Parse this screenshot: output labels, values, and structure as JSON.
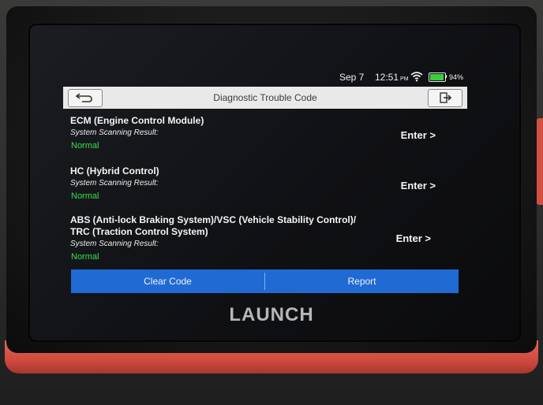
{
  "status_bar": {
    "date": "Sep 7",
    "time": "12:51",
    "time_suffix": "PM",
    "battery": "94%",
    "battery_fraction": 0.94,
    "colors": {
      "battery_fill": "#3ccd3a"
    }
  },
  "header": {
    "title": "Diagnostic Trouble Code",
    "back_icon": "back-arrow-icon",
    "exit_icon": "exit-icon"
  },
  "systems": [
    {
      "name": "ECM (Engine Control Module)",
      "result_label": "System Scanning Result:",
      "result": "Normal",
      "enter_label": "Enter >"
    },
    {
      "name": "HC (Hybrid Control)",
      "result_label": "System Scanning Result:",
      "result": "Normal",
      "enter_label": "Enter >"
    },
    {
      "name_line1": "ABS (Anti-lock Braking System)/VSC (Vehicle Stability Control)/",
      "name_line2": "TRC (Traction Control System)",
      "result_label": "System Scanning Result:",
      "result": "Normal",
      "enter_label": "Enter >"
    }
  ],
  "footer": {
    "clear_label": "Clear Code",
    "report_label": "Report",
    "colors": {
      "bar": "#1f6bd3",
      "ok": "#37e04b"
    }
  },
  "device": {
    "brand": "LAUNCH"
  }
}
